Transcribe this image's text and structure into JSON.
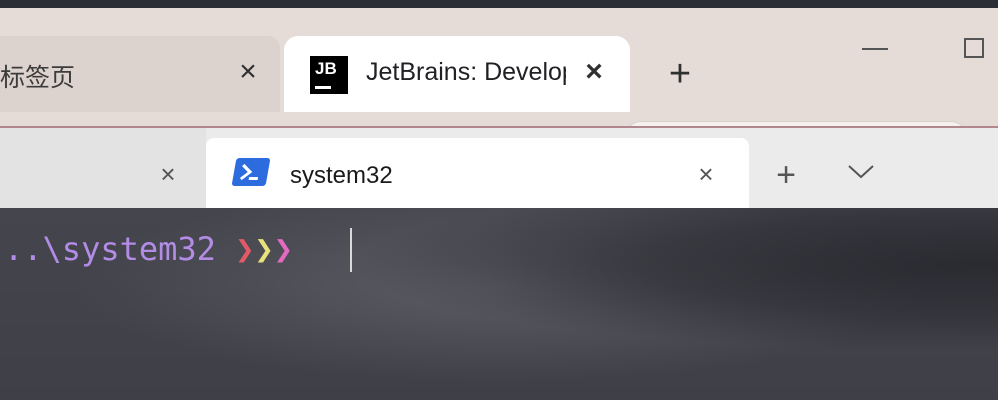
{
  "browser": {
    "tabs": [
      {
        "label": "标签页",
        "active": false
      },
      {
        "label": "JetBrains: Developer Tools for Professionals and Teams",
        "active": true,
        "favicon": "JB"
      }
    ],
    "close_icon": "×",
    "new_tab_icon": "+"
  },
  "terminal": {
    "tabs": [
      {
        "label": "",
        "active": false
      },
      {
        "label": "system32",
        "active": true,
        "icon": "powershell-icon"
      }
    ],
    "close_icon": "×",
    "new_tab_icon": "+",
    "prompt": {
      "path": "..\\system32 ",
      "chevrons": [
        {
          "char": "❯",
          "color": "#e35a66"
        },
        {
          "char": "❯",
          "color": "#e9e27a"
        },
        {
          "char": "❯",
          "color": "#e36ac1"
        }
      ],
      "color": "#b38ce8"
    }
  }
}
